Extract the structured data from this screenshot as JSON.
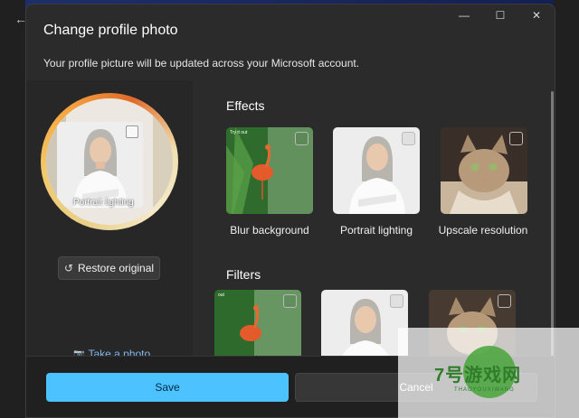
{
  "dialog": {
    "title": "Change profile photo",
    "subtitle": "Your profile picture will be updated across your Microsoft account."
  },
  "titlebar": {
    "minimize_glyph": "—",
    "maximize_glyph": "☐",
    "close_glyph": "✕"
  },
  "background": {
    "back_glyph": "←"
  },
  "preview": {
    "caption": "Portrait lighting"
  },
  "left": {
    "restore_label": "Restore original",
    "restore_glyph": "↺",
    "take_photo_label": "Take a photo",
    "camera_glyph": "📷"
  },
  "effects": {
    "title": "Effects",
    "items": [
      {
        "label": "Blur background",
        "badge": "Try it out"
      },
      {
        "label": "Portrait lighting",
        "badge": ""
      },
      {
        "label": "Upscale resolution",
        "badge": ""
      }
    ]
  },
  "filters": {
    "title": "Filters",
    "items": [
      {
        "label": "",
        "badge": "out"
      },
      {
        "label": "",
        "badge": ""
      },
      {
        "label": "",
        "badge": ""
      }
    ]
  },
  "footer": {
    "save_label": "Save",
    "cancel_label": "Cancel"
  },
  "watermark": {
    "text": "7号游戏网",
    "sub": "THAOYOUXIWANG"
  },
  "colors": {
    "accent": "#4cc2ff",
    "dialog_bg": "#2b2b2b",
    "link": "#7fb6ee"
  }
}
